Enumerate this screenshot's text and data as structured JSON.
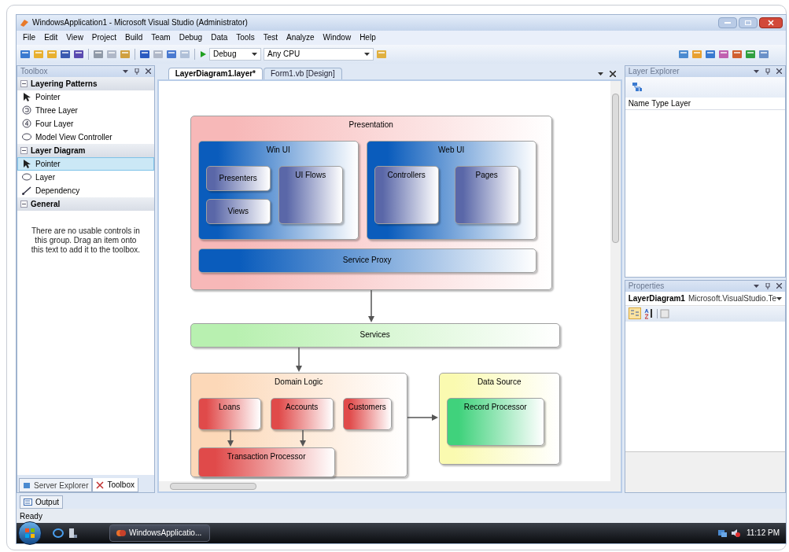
{
  "window": {
    "title": "WindowsApplication1 - Microsoft Visual Studio (Administrator)"
  },
  "menu": [
    "File",
    "Edit",
    "View",
    "Project",
    "Build",
    "Team",
    "Debug",
    "Data",
    "Tools",
    "Test",
    "Analyze",
    "Window",
    "Help"
  ],
  "toolbar": {
    "configuration": "Debug",
    "platform": "Any CPU"
  },
  "toolbox": {
    "title": "Toolbox",
    "groups": [
      {
        "label": "Layering Patterns",
        "expanded": true,
        "items": [
          {
            "label": "Pointer",
            "kind": "pointer",
            "selected": false
          },
          {
            "label": "Three Layer",
            "kind": "three",
            "selected": false
          },
          {
            "label": "Four Layer",
            "kind": "four",
            "selected": false
          },
          {
            "label": "Model View Controller",
            "kind": "oval",
            "selected": false
          }
        ]
      },
      {
        "label": "Layer Diagram",
        "expanded": true,
        "items": [
          {
            "label": "Pointer",
            "kind": "pointer",
            "selected": true
          },
          {
            "label": "Layer",
            "kind": "oval",
            "selected": false
          },
          {
            "label": "Dependency",
            "kind": "line",
            "selected": false
          }
        ]
      },
      {
        "label": "General",
        "expanded": true,
        "message": "There are no usable controls in this group. Drag an item onto this text to add it to the toolbox."
      }
    ]
  },
  "toolbox_tabs": [
    {
      "label": "Server Explorer",
      "selected": false
    },
    {
      "label": "Toolbox",
      "selected": true
    }
  ],
  "document_tabs": [
    {
      "label": "LayerDiagram1.layer*",
      "selected": true
    },
    {
      "label": "Form1.vb [Design]",
      "selected": false
    }
  ],
  "diagram": {
    "layers": [
      {
        "name": "Presentation",
        "color": "#f7b8b8",
        "children": [
          {
            "name": "Win UI",
            "color": "#0a5cbc",
            "children": [
              {
                "name": "Presenters",
                "color": "#5a67a8"
              },
              {
                "name": "UI Flows",
                "color": "#5a67a8"
              },
              {
                "name": "Views",
                "color": "#5a67a8"
              }
            ]
          },
          {
            "name": "Web UI",
            "color": "#0a5cbc",
            "children": [
              {
                "name": "Controllers",
                "color": "#5a67a8"
              },
              {
                "name": "Pages",
                "color": "#5a67a8"
              }
            ]
          },
          {
            "name": "Service Proxy",
            "color": "#0a5cbc"
          }
        ]
      },
      {
        "name": "Services",
        "color": "#b8f0b0"
      },
      {
        "name": "Domain Logic",
        "color": "#fcd8b8",
        "children": [
          {
            "name": "Loans",
            "color": "#e04a4a"
          },
          {
            "name": "Accounts",
            "color": "#e04a4a"
          },
          {
            "name": "Customers",
            "color": "#e04a4a"
          },
          {
            "name": "Transaction Processor",
            "color": "#e04a4a"
          }
        ]
      },
      {
        "name": "Data Source",
        "color": "#fafab0",
        "children": [
          {
            "name": "Record Processor",
            "color": "#40d27c"
          }
        ]
      }
    ]
  },
  "layer_explorer": {
    "title": "Layer Explorer",
    "columns": [
      "Name",
      "Type",
      "Layer"
    ]
  },
  "properties": {
    "title": "Properties",
    "object": "LayerDiagram1",
    "type": "Microsoft.VisualStudio.Te"
  },
  "output_tab": "Output",
  "status_bar": "Ready",
  "taskbar": {
    "task": "WindowsApplicatio...",
    "time": "11:12 PM"
  }
}
